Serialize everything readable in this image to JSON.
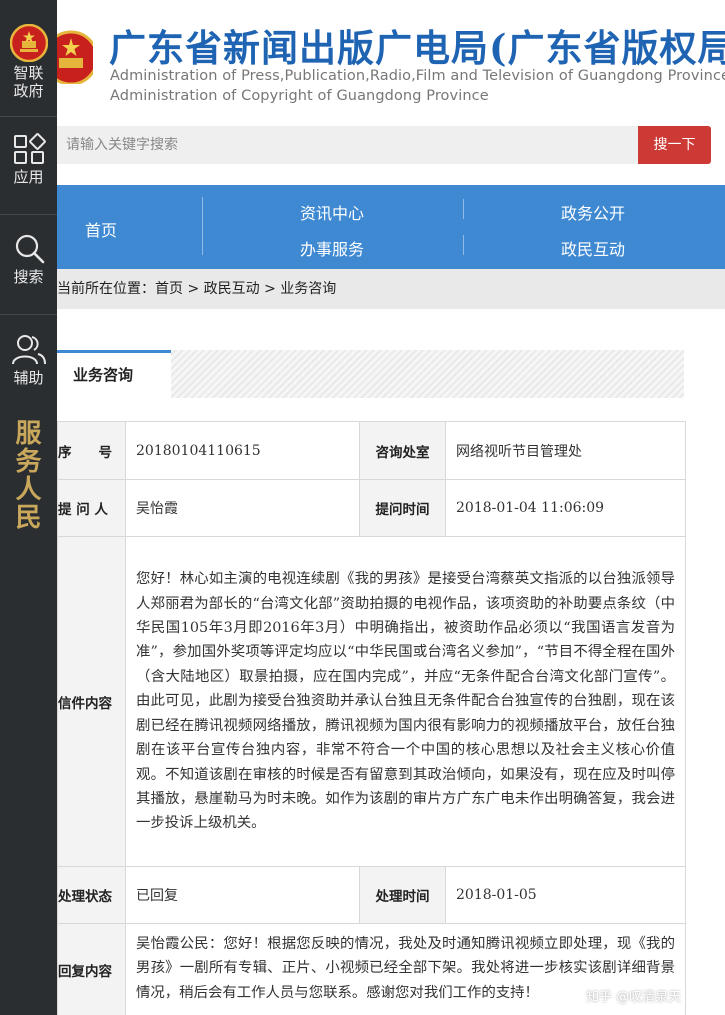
{
  "sidebar": {
    "items": [
      {
        "label_line1": "智联",
        "label_line2": "政府",
        "icon": "party-emblem-icon"
      },
      {
        "label": "应用",
        "icon": "apps-grid-icon"
      },
      {
        "label": "搜索",
        "icon": "search-icon"
      },
      {
        "label": "辅助",
        "icon": "accessibility-people-icon"
      }
    ],
    "slogan": [
      "服",
      "务",
      "人",
      "民"
    ]
  },
  "header": {
    "title_cn": "广东省新闻出版广电局(广东省版权局)",
    "title_en_line1": "Administration of Press,Publication,Radio,Film and Television of Guangdong Province",
    "title_en_line2": "Administration of Copyright of Guangdong Province"
  },
  "search": {
    "placeholder": "请输入关键字搜索",
    "button_label": "搜一下"
  },
  "nav": {
    "home": "首页",
    "news": "资讯中心",
    "affairs": "政务公开",
    "services": "办事服务",
    "interaction": "政民互动"
  },
  "breadcrumb": {
    "prefix": "当前所在位置：",
    "path": "首页 > 政民互动 > 业务咨询"
  },
  "section": {
    "tab_label": "业务咨询"
  },
  "detail": {
    "serial_label": "序　　号",
    "serial_value": "20180104110615",
    "office_label": "咨询处室",
    "office_value": "网络视听节目管理处",
    "asker_label": "提 问 人",
    "asker_value": "吴怡霞",
    "ask_time_label": "提问时间",
    "ask_time_value": "2018-01-04 11:06:09",
    "letter_label": "信件内容",
    "letter_content": "您好！林心如主演的电视连续剧《我的男孩》是接受台湾蔡英文指派的以台独派领导人郑丽君为部长的“台湾文化部”资助拍摄的电视作品，该项资助的补助要点条纹（中华民国105年3月即2016年3月）中明确指出，被资助作品必须以“我国语言发音为准”，参加国外奖项等评定均应以“中华民国或台湾名义参加”，“节目不得全程在国外（含大陆地区）取景拍摄，应在国内完成”，并应“无条件配合台湾文化部门宣传”。由此可见，此剧为接受台独资助并承认台独且无条件配合台独宣传的台独剧，现在该剧已经在腾讯视频网络播放，腾讯视频为国内很有影响力的视频播放平台，放任台独剧在该平台宣传台独内容，非常不符合一个中国的核心思想以及社会主义核心价值观。不知道该剧在审核的时候是否有留意到其政治倾向，如果没有，现在应及时叫停其播放，悬崖勒马为时未晚。如作为该剧的审片方广东广电未作出明确答复，我会进一步投诉上级机关。",
    "status_label": "处理状态",
    "status_value": "已回复",
    "handle_time_label": "处理时间",
    "handle_time_value": "2018-01-05",
    "reply_label": "回复内容",
    "reply_content": "吴怡霞公民：您好！根据您反映的情况，我处及时通知腾讯视频立即处理，现《我的男孩》一剧所有专辑、正片、小视频已经全部下架。我处将进一步核实该剧详细背景情况，稍后会有工作人员与您联系。感谢您对我们工作的支持！"
  },
  "watermark": "知乎 @叹清泉天",
  "colors": {
    "brand_blue": "#1f63b3",
    "nav_blue": "#3e89d2",
    "search_red": "#cd3a36",
    "sidebar_dark": "#2b2e31",
    "slogan_gold": "#c9a85c"
  }
}
